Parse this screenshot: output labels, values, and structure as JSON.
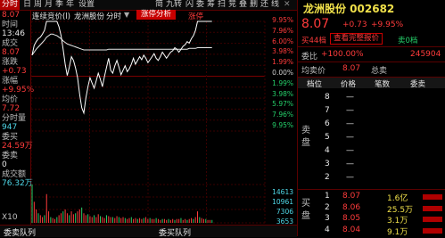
{
  "toolbar": {
    "items": [
      "分时",
      "日",
      "周",
      "月",
      "季",
      "年",
      "设置"
    ],
    "right_items": [
      "简",
      "九转",
      "闪",
      "委",
      "筹",
      "扫",
      "竞",
      "叠",
      "删",
      "还",
      "线"
    ]
  },
  "chart_header": {
    "tab_auction": "连续竞价(l)",
    "stock_name": "龙洲股份",
    "period": "分时",
    "menu_icon": "▼",
    "limit_up_analysis": "涨停分析",
    "limit_up_text": "涨停"
  },
  "left_panel": {
    "price_top": "8.07",
    "time_label": "时间",
    "time_value": "13:46",
    "volume_label": "成交",
    "volume_value": "8.07",
    "change_label": "涨跌",
    "change_value": "+0.73",
    "pct_label": "涨幅",
    "pct_value": "+9.95%",
    "avg_label": "均价",
    "avg_value": "7.72",
    "min_vol_label": "分时量",
    "min_vol_value": "947",
    "amount_label": "委买",
    "amount_value": "24.59万",
    "sell_label": "委卖",
    "sell_value": "0",
    "turnover_label": "成交额",
    "turnover_value": "76.32万",
    "x10": "X10"
  },
  "axis": {
    "price_labels": [
      "9.95%",
      "7.96%",
      "6.00%",
      "3.98%",
      "1.99%",
      "0.00%",
      "1.99%",
      "3.98%",
      "5.97%",
      "7.96%",
      "9.95%"
    ],
    "vol_labels": [
      "14613",
      "10961",
      "7306",
      "3653"
    ]
  },
  "price_data": {
    "prev_close": 7.34,
    "limit_up": 8.07,
    "limit_down": 6.61,
    "price": [
      7.62,
      7.75,
      7.8,
      7.84,
      7.86,
      7.9,
      7.95,
      8.07,
      8.07,
      8.07,
      8.07,
      8.07,
      8.07,
      8.0,
      7.88,
      7.7,
      7.5,
      7.35,
      7.46,
      7.6,
      7.55,
      7.45,
      7.32,
      7.1,
      6.92,
      6.85,
      7.05,
      7.2,
      7.32,
      7.25,
      7.18,
      7.28,
      7.38,
      7.3,
      7.2,
      7.34,
      7.46,
      7.58,
      7.42,
      7.38,
      7.48,
      7.55,
      7.46,
      7.36,
      7.42,
      7.48,
      7.4,
      7.44,
      7.5,
      7.58,
      7.5,
      7.55,
      7.6,
      7.56,
      7.62,
      7.58,
      7.52,
      7.56,
      7.6,
      7.64,
      7.58,
      7.55,
      7.6,
      7.66,
      7.62,
      7.58,
      7.62,
      7.66,
      7.68,
      7.72,
      7.7,
      7.66,
      7.7,
      7.74,
      7.76,
      7.8,
      7.78,
      7.84,
      7.88,
      7.95,
      8.07,
      8.07,
      8.07,
      8.07,
      8.07,
      8.07,
      8.07,
      8.07
    ],
    "avg": [
      7.62,
      7.66,
      7.7,
      7.73,
      7.76,
      7.79,
      7.82,
      7.86,
      7.88,
      7.9,
      7.9,
      7.89,
      7.88,
      7.86,
      7.84,
      7.81,
      7.79,
      7.77,
      7.76,
      7.75,
      7.74,
      7.73,
      7.72,
      7.71,
      7.7,
      7.69,
      7.69,
      7.69,
      7.69,
      7.69,
      7.69,
      7.69,
      7.69,
      7.69,
      7.69,
      7.69,
      7.69,
      7.7,
      7.7,
      7.7,
      7.7,
      7.7,
      7.7,
      7.7,
      7.7,
      7.7,
      7.7,
      7.7,
      7.7,
      7.7,
      7.7,
      7.7,
      7.7,
      7.7,
      7.7,
      7.7,
      7.7,
      7.7,
      7.7,
      7.7,
      7.7,
      7.7,
      7.7,
      7.7,
      7.7,
      7.7,
      7.7,
      7.7,
      7.7,
      7.7,
      7.7,
      7.7,
      7.7,
      7.7,
      7.7,
      7.7,
      7.71,
      7.71,
      7.71,
      7.71,
      7.72,
      7.72,
      7.72,
      7.72,
      7.72,
      7.72,
      7.72,
      7.72
    ]
  },
  "right_panel": {
    "stock_title": "龙洲股份 002682",
    "price": "8.07",
    "change": "+0.73",
    "pct": "+9.95%",
    "buy_count": "买44档",
    "orderbook_btn": "查看完整报价",
    "sell_zero": "卖0档",
    "weibi_label": "委比",
    "weibi_value": "+100.00%",
    "weicha_value": "245904",
    "jun_label": "均卖价",
    "jun_value": "8.07",
    "total_sell_label": "总卖",
    "col_headers": [
      "档位",
      "价格",
      "笔数",
      "委卖"
    ],
    "sell_rows": [
      {
        "level": "8",
        "price": "—"
      },
      {
        "level": "7",
        "price": "—"
      },
      {
        "level": "6",
        "price": "—"
      },
      {
        "level": "5",
        "price": "—"
      },
      {
        "level": "4",
        "price": "—"
      },
      {
        "level": "3",
        "price": "—"
      },
      {
        "level": "2",
        "price": "—"
      }
    ],
    "side_label_sell": "卖\n盘",
    "buy_rows": [
      {
        "level": "1",
        "price": "8.07",
        "count": "1.6亿"
      },
      {
        "level": "2",
        "price": "8.06",
        "count": "25.5万"
      },
      {
        "level": "3",
        "price": "8.05",
        "count": "3.1万"
      },
      {
        "level": "4",
        "price": "8.04",
        "count": "9.1万"
      }
    ],
    "side_label_buy": "买\n盘"
  },
  "bottom": {
    "left": "委卖队列",
    "right": "委买队列"
  }
}
